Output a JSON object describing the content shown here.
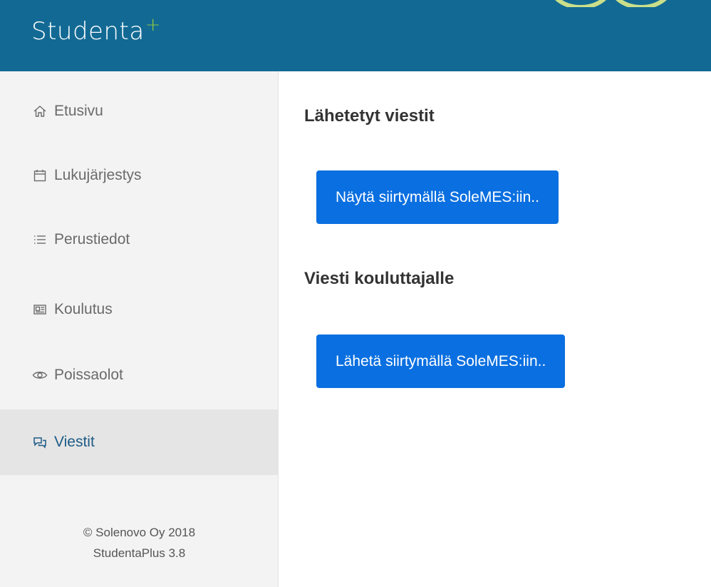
{
  "app": {
    "brand": "Studenta",
    "brand_plus": "+"
  },
  "sidebar": {
    "items": [
      {
        "label": "Etusivu",
        "icon": "home-icon",
        "active": false
      },
      {
        "label": "Lukujärjestys",
        "icon": "calendar-icon",
        "active": false
      },
      {
        "label": "Perustiedot",
        "icon": "list-icon",
        "active": false
      },
      {
        "label": "Koulutus",
        "icon": "id-card-icon",
        "active": false
      },
      {
        "label": "Poissaolot",
        "icon": "eye-icon",
        "active": false
      },
      {
        "label": "Viestit",
        "icon": "chat-icon",
        "active": true
      }
    ],
    "footer": {
      "copyright": "© Solenovo Oy 2018",
      "version": "StudentaPlus 3.8"
    }
  },
  "main": {
    "sent_title": "Lähetetyt viestit",
    "sent_button": "Näytä siirtymällä SoleMES:iin..",
    "message_title": "Viesti kouluttajalle",
    "message_button": "Lähetä siirtymällä SoleMES:iin.."
  },
  "colors": {
    "header": "#126a94",
    "accent_plus": "#8dc63f",
    "button": "#0a6fe0",
    "active_nav": "#1d5b86"
  }
}
